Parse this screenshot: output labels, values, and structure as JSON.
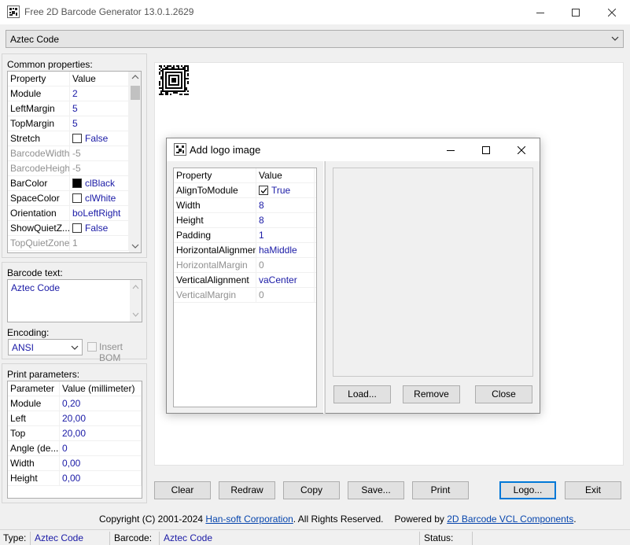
{
  "window": {
    "title": "Free 2D Barcode Generator 13.0.1.2629"
  },
  "type_combo": {
    "value": "Aztec Code"
  },
  "common": {
    "label": "Common properties:",
    "header": [
      "Property",
      "Value"
    ],
    "rows": [
      {
        "name": "Module",
        "value": "2"
      },
      {
        "name": "LeftMargin",
        "value": "5"
      },
      {
        "name": "TopMargin",
        "value": "5"
      },
      {
        "name": "Stretch",
        "value": "False"
      },
      {
        "name": "BarcodeWidth",
        "value": "-5"
      },
      {
        "name": "BarcodeHeight",
        "value": "-5"
      },
      {
        "name": "BarColor",
        "value": "clBlack"
      },
      {
        "name": "SpaceColor",
        "value": "clWhite"
      },
      {
        "name": "Orientation",
        "value": "boLeftRight"
      },
      {
        "name": "ShowQuietZ...",
        "value": "False"
      },
      {
        "name": "TopQuietZone",
        "value": "1"
      }
    ],
    "bar_color": "#000000",
    "space_color": "#ffffff"
  },
  "barcode_text": {
    "label": "Barcode text:",
    "value": "Aztec Code"
  },
  "encoding": {
    "label": "Encoding:",
    "value": "ANSI",
    "insert_bom": "Insert BOM"
  },
  "print": {
    "label": "Print parameters:",
    "header": [
      "Parameter",
      "Value (millimeter)"
    ],
    "rows": [
      {
        "name": "Module",
        "value": "0,20"
      },
      {
        "name": "Left",
        "value": "20,00"
      },
      {
        "name": "Top",
        "value": "20,00"
      },
      {
        "name": "Angle (de...",
        "value": "0"
      },
      {
        "name": "Width",
        "value": "0,00"
      },
      {
        "name": "Height",
        "value": "0,00"
      }
    ]
  },
  "buttons": {
    "clear": "Clear",
    "redraw": "Redraw",
    "copy": "Copy",
    "save": "Save...",
    "print": "Print",
    "logo": "Logo...",
    "exit": "Exit"
  },
  "footer": {
    "copyright": "Copyright (C) 2001-2024 ",
    "company": "Han-soft Corporation",
    "rights": ". All Rights Reserved.",
    "powered": "Powered by ",
    "components": "2D Barcode VCL Components",
    "period": "."
  },
  "statusbar": {
    "type_label": "Type:",
    "type_value": "Aztec Code",
    "barcode_label": "Barcode:",
    "barcode_value": "Aztec Code",
    "status_label": "Status:"
  },
  "dialog": {
    "title": "Add logo image",
    "header": [
      "Property",
      "Value"
    ],
    "rows": [
      {
        "name": "AlignToModule",
        "value": "True"
      },
      {
        "name": "Width",
        "value": "8"
      },
      {
        "name": "Height",
        "value": "8"
      },
      {
        "name": "Padding",
        "value": "1"
      },
      {
        "name": "HorizontalAlignment",
        "value": "haMiddle"
      },
      {
        "name": "HorizontalMargin",
        "value": "0"
      },
      {
        "name": "VerticalAlignment",
        "value": "vaCenter"
      },
      {
        "name": "VerticalMargin",
        "value": "0"
      }
    ],
    "load": "Load...",
    "remove": "Remove",
    "close": "Close"
  },
  "icons": {
    "app": "barcode-app-icon",
    "minimize": "minimize-icon",
    "maximize": "maximize-icon",
    "close": "close-icon",
    "dropdown": "chevron-down-icon"
  }
}
